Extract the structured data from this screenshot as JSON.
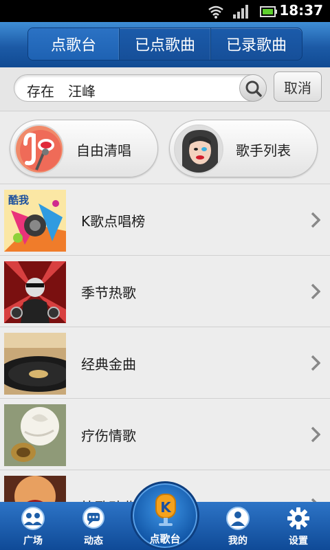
{
  "status_bar": {
    "time": "18:37"
  },
  "tabs": [
    {
      "label": "点歌台",
      "active": true
    },
    {
      "label": "已点歌曲",
      "active": false
    },
    {
      "label": "已录歌曲",
      "active": false
    }
  ],
  "search": {
    "query": "存在　汪峰",
    "cancel_label": "取消"
  },
  "quick_actions": [
    {
      "label": "自由清唱"
    },
    {
      "label": "歌手列表"
    }
  ],
  "list": [
    {
      "title": "K歌点唱榜",
      "thumb_text": "酷我"
    },
    {
      "title": "季节热歌"
    },
    {
      "title": "经典金曲"
    },
    {
      "title": "疗伤情歌"
    },
    {
      "title": "快歌劲曲"
    }
  ],
  "bottom_nav": [
    {
      "label": "广场"
    },
    {
      "label": "动态"
    },
    {
      "label": "点歌台"
    },
    {
      "label": "我的"
    },
    {
      "label": "设置"
    }
  ],
  "colors": {
    "header_blue": "#1c5aa6",
    "nav_blue": "#1255a6",
    "accent_orange": "#f5a21c"
  }
}
